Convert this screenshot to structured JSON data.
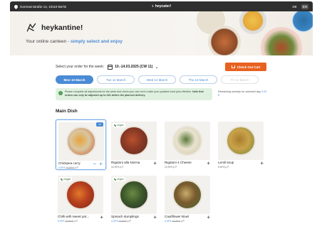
{
  "topbar": {
    "address": "Gormannstraße 14, 10119 Berlin",
    "brand": "heycater!",
    "languages": [
      "DE",
      "EN"
    ],
    "active_language": "EN"
  },
  "hero": {
    "logo_text": "heykantine!",
    "tagline_prefix": "Your online canteen - ",
    "tagline_highlight": "simply select and enjoy"
  },
  "order": {
    "label": "Select your order for the week:",
    "week_range": "10.-14.03.2025 (CW 11)",
    "checkout_label": "Check Out Cart"
  },
  "days": [
    {
      "label": "Mon 10 March",
      "state": "active"
    },
    {
      "label": "Tue 11 March",
      "state": "normal"
    },
    {
      "label": "Wed 12 March",
      "state": "normal"
    },
    {
      "label": "Thu 13 March",
      "state": "normal"
    },
    {
      "label": "Fri 14 March",
      "state": "disabled"
    }
  ],
  "notice": {
    "text": "Please complete all adjustments for the week and check your cart out to make your updated meal plan effective. ",
    "bold": "Note that orders can only be adjusted up to 24h before the planned delivery."
  },
  "subsidy": {
    "label": "Remaining subsidy for selected day",
    "amount": "0.00 €"
  },
  "section_title": "Main Dish",
  "dishes": [
    {
      "name": "Chickpea curry",
      "price": "4,99 €",
      "old_price": "10,99 €",
      "unit": "p.P.",
      "tag": "",
      "qty": "1x",
      "selected": true,
      "colors": [
        "#d9c6a0",
        "#e8a33a",
        "#c95a2b"
      ]
    },
    {
      "name": "Rigatoni alla Norma",
      "price": "10,99 €",
      "old_price": "",
      "unit": "p.P.",
      "tag": "vegan",
      "qty": "",
      "selected": false,
      "colors": [
        "#8a3a25",
        "#b9502d",
        "#5f2a1d"
      ]
    },
    {
      "name": "Rigatoni 4 Cheese",
      "price": "10,99 €",
      "old_price": "",
      "unit": "p.P.",
      "tag": "",
      "qty": "",
      "selected": false,
      "colors": [
        "#e9e3cf",
        "#5c7a3a",
        "#cfc7a8"
      ]
    },
    {
      "name": "Lentil soup",
      "price": "5,69 €",
      "old_price": "",
      "unit": "p.P.",
      "tag": "",
      "qty": "",
      "selected": false,
      "colors": [
        "#c9a24a",
        "#a87d2e",
        "#6d8a3a"
      ]
    },
    {
      "name": "Chilli with sweet pot...",
      "price": "5,99 €",
      "old_price": "10,99 €",
      "unit": "p.P.",
      "tag": "veggie",
      "qty": "",
      "selected": false,
      "colors": [
        "#b8401f",
        "#e07a2a",
        "#7a2618"
      ]
    },
    {
      "name": "Spinach dumplings",
      "price": "4,39 €",
      "old_price": "10,99 €",
      "unit": "p.P.",
      "tag": "vegan",
      "qty": "",
      "selected": false,
      "colors": [
        "#3d5a2a",
        "#6b8a45",
        "#2a2a2a"
      ]
    },
    {
      "name": "Cauliflower Bowl",
      "price": "4,39 €",
      "old_price": "10,99 €",
      "unit": "p.P.",
      "tag": "",
      "qty": "",
      "selected": false,
      "colors": [
        "#7a5a2e",
        "#c7ad6a",
        "#4b6a35"
      ]
    }
  ],
  "colors": {
    "accent_blue": "#4a8bd6",
    "checkout_orange": "#e8611f",
    "notice_green": "#dff0e0"
  }
}
